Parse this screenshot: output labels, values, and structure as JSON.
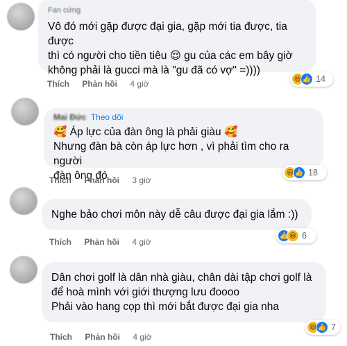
{
  "comments": [
    {
      "author": "Fan cứng",
      "follow": "",
      "lines": "Vô đó mới gặp được đại gia, gặp mới tia được, tia được\nthì có người cho tiền tiêu 😌 gu của các em bây giờ\nkhông phải là gucci mà là \"gu đã có vợ\" =))))",
      "like": "Thích",
      "reply": "Phản hồi",
      "time": "4 giờ",
      "reaction_icons": [
        "haha",
        "like"
      ],
      "reaction_count": "14"
    },
    {
      "author": "Mai Đức",
      "follow": "Theo dõi",
      "lines": "🥰 Áp lực của đàn ông là phải giàu 🥰\nNhưng đàn bà còn áp lực hơn , vì phải tìm cho ra người\nđàn ông đó",
      "like": "Thích",
      "reply": "Phản hồi",
      "time": "3 giờ",
      "reaction_icons": [
        "haha",
        "like"
      ],
      "reaction_count": "18"
    },
    {
      "author": "",
      "follow": "",
      "lines": "Nghe bảo chơi môn này dễ câu được đại gia lắm :))",
      "like": "Thích",
      "reply": "Phản hồi",
      "time": "4 giờ",
      "reaction_icons": [
        "like",
        "haha"
      ],
      "reaction_count": "6"
    },
    {
      "author": "",
      "follow": "",
      "lines": "Dân chơi golf là dân nhà giàu, chân dài tập chơi golf là\nđể hoà mình với giới thượng lưu đoooo\nPhải vào hang cọp thì mới bắt được đại gia nha",
      "like": "Thích",
      "reply": "Phản hồi",
      "time": "4 giờ",
      "reaction_icons": [
        "haha",
        "like"
      ],
      "reaction_count": "7"
    }
  ],
  "colors": {
    "bubble": "#f0f2f5",
    "secondary_text": "#65676b",
    "link_blue": "#1877f2",
    "haha_yellow": "#f7b928"
  },
  "icons": {
    "haha": "haha-reaction-icon",
    "like": "like-reaction-icon"
  }
}
